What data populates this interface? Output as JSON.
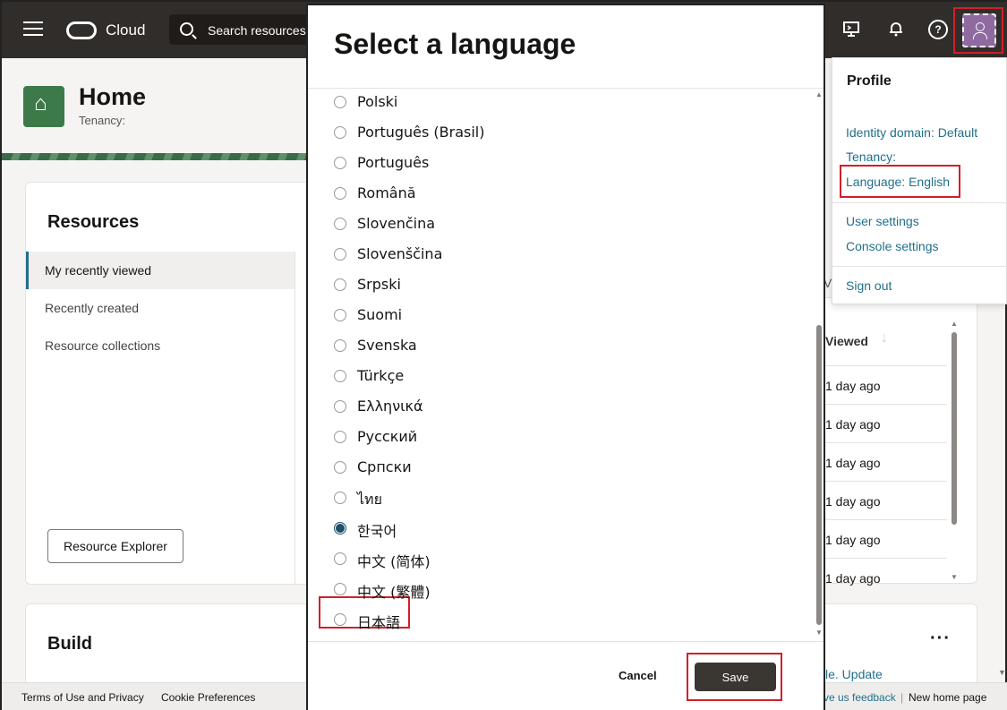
{
  "topbar": {
    "brand": "Cloud",
    "search_placeholder": "Search resources"
  },
  "home": {
    "title": "Home",
    "tenancy_label": "Tenancy:"
  },
  "resources": {
    "title": "Resources",
    "tabs": [
      "My recently viewed",
      "Recently created",
      "Resource collections"
    ],
    "explorer_button": "Resource Explorer"
  },
  "build": {
    "title": "Build"
  },
  "recent_panel": {
    "header": "Viewed",
    "rows": [
      "1 day ago",
      "1 day ago",
      "1 day ago",
      "1 day ago",
      "1 day ago",
      "1 day ago"
    ],
    "update_text": "le. Update",
    "side_mark": "V"
  },
  "footer": {
    "terms": "Terms of Use and Privacy",
    "cookies": "Cookie Preferences",
    "feedback": "ve us feedback",
    "separator": "|",
    "new_home": "New home page"
  },
  "profile": {
    "title": "Profile",
    "identity_domain": "Identity domain: Default",
    "tenancy": "Tenancy:",
    "language": "Language: English",
    "user_settings": "User settings",
    "console_settings": "Console settings",
    "sign_out": "Sign out"
  },
  "modal": {
    "title": "Select a language",
    "languages": [
      "Polski",
      "Português (Brasil)",
      "Português",
      "Română",
      "Slovenčina",
      "Slovenščina",
      "Srpski",
      "Suomi",
      "Svenska",
      "Türkçe",
      "Ελληνικά",
      "Русский",
      "Српски",
      "ไทย",
      "한국어",
      "中文 (简体)",
      "中文 (繁體)",
      "日本語"
    ],
    "selected": "한국어",
    "cancel_label": "Cancel",
    "save_label": "Save"
  },
  "colors": {
    "topbar_bg": "#312d2a",
    "highlight_red": "#d0202a",
    "link_teal": "#1f6f8b",
    "save_bg": "#3a3632"
  }
}
